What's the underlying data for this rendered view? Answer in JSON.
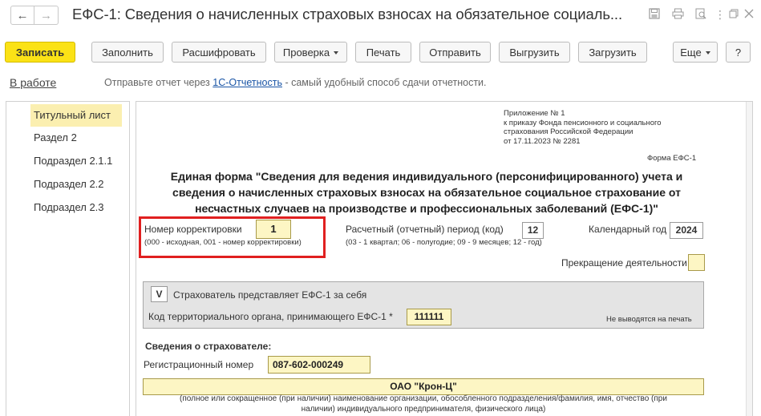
{
  "window": {
    "title": "ЕФС-1: Сведения о начисленных страховых взносах на обязательное социаль...",
    "nav_back": "←",
    "nav_forward": "→",
    "icons": [
      "save-icon",
      "print-icon",
      "preview-icon",
      "more-icon",
      "restore-icon",
      "close-icon"
    ]
  },
  "toolbar": {
    "record": "Записать",
    "fill": "Заполнить",
    "decode": "Расшифровать",
    "check": "Проверка",
    "print": "Печать",
    "send": "Отправить",
    "export": "Выгрузить",
    "import": "Загрузить",
    "more": "Еще",
    "help": "?"
  },
  "status": {
    "state": "В работе",
    "hint_before": "Отправьте отчет через ",
    "hint_link": "1С-Отчетность",
    "hint_after": " - самый удобный способ сдачи отчетности."
  },
  "sections": [
    "Титульный лист",
    "Раздел 2",
    "Подраздел 2.1.1",
    "Подраздел 2.2",
    "Подраздел 2.3"
  ],
  "form": {
    "appendix_1": "Приложение № 1",
    "appendix_2": "к приказу Фонда пенсионного и социального",
    "appendix_3": "страхования Российской Федерации",
    "appendix_4": "от 17.11.2023 № 2281",
    "form_code": "Форма ЕФС-1",
    "heading_1": "Единая форма \"Сведения для ведения индивидуального (персонифицированного) учета и",
    "heading_2": "сведения о начисленных страховых взносах на обязательное социальное страхование от",
    "heading_3": "несчастных случаев на производстве и профессиональных заболеваний (ЕФС-1)\"",
    "correction_label": "Номер корректировки",
    "correction_value": "1",
    "correction_hint": "(000 - исходная, 001 - номер корректировки)",
    "period_label": "Расчетный (отчетный) период (код)",
    "period_value": "12",
    "period_hint": "(03 - 1 квартал; 06 - полугодие; 09 - 9 месяцев; 12 - год)",
    "year_label": "Календарный год",
    "year_value": "2024",
    "termination_label": "Прекращение деятельности",
    "self_check": "V",
    "self_label": "Страхователь представляет ЕФС-1 за себя",
    "terr_label": "Код территориального органа, принимающего ЕФС-1 *",
    "terr_value": "111111",
    "not_printed": "Не выводятся на печать",
    "insurer_header": "Сведения о страхователе:",
    "reg_label": "Регистрационный номер",
    "reg_value": "087-602-000249",
    "org_name": "ОАО \"Крон-Ц\"",
    "org_hint_1": "(полное или сокращенное (при наличии) наименование организации, обособленного подразделения/фамилия, имя, отчество (при",
    "org_hint_2": "наличии) индивидуального предпринимателя, физического лица)"
  }
}
